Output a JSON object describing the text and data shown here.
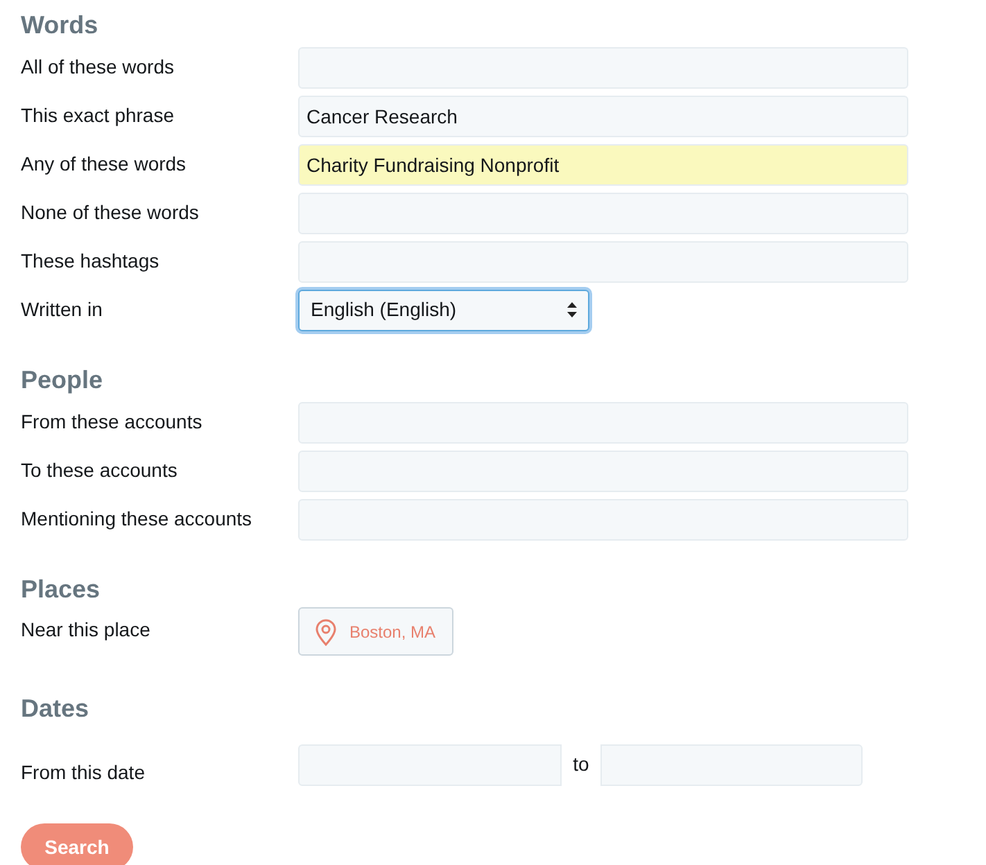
{
  "sections": [
    {
      "title": "Words",
      "rows": [
        {
          "kind": "text",
          "label": "All of these words",
          "highlighted": false
        },
        {
          "kind": "text",
          "label": "This exact phrase",
          "value": "Cancer Research",
          "highlighted": false
        },
        {
          "kind": "text",
          "label": "Any of these words",
          "value": "Charity Fundraising Nonprofit",
          "highlighted": true
        },
        {
          "kind": "text",
          "label": "None of these words",
          "highlighted": false
        },
        {
          "kind": "text",
          "label": "These hashtags",
          "highlighted": false
        },
        {
          "kind": "select",
          "label": "Written in",
          "value": "English (English)",
          "focused": true
        }
      ]
    },
    {
      "title": "People",
      "rows": [
        {
          "kind": "text",
          "label": "From these accounts",
          "highlighted": false
        },
        {
          "kind": "text",
          "label": "To these accounts",
          "highlighted": false
        },
        {
          "kind": "text",
          "label": "Mentioning these accounts",
          "highlighted": false
        }
      ]
    },
    {
      "title": "Places",
      "rows": [
        {
          "kind": "location",
          "label": "Near this place",
          "value": "Boston, MA"
        }
      ]
    },
    {
      "title": "Dates",
      "rows": [
        {
          "kind": "daterange",
          "label": "From this date",
          "separator": "to"
        }
      ]
    }
  ],
  "search_button": "Search"
}
